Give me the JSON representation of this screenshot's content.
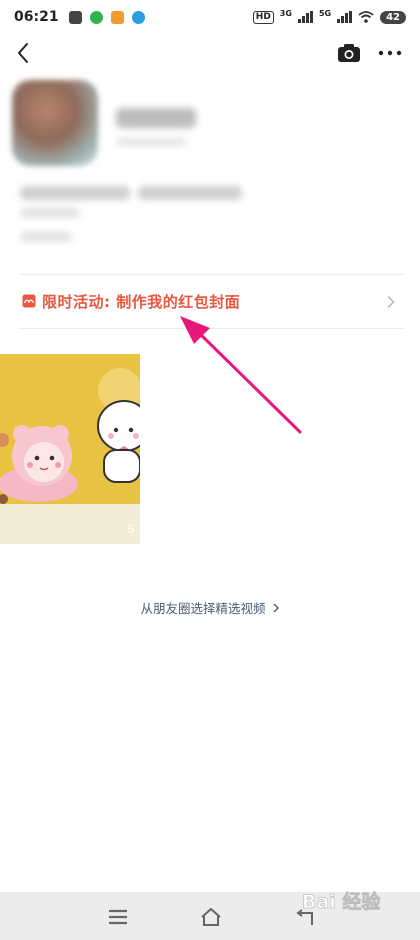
{
  "status_bar": {
    "time": "06:21",
    "hd_label": "HD",
    "net1": "3G",
    "net2": "5G",
    "battery": "42"
  },
  "nav": {
    "back_icon": "chevron-left-icon",
    "camera_icon": "camera-icon",
    "more_icon": "more-dots-icon"
  },
  "activity": {
    "label": "限时活动: 制作我的红包封面",
    "accent_color": "#e8573e"
  },
  "video": {
    "count": "5"
  },
  "moments_link": {
    "label": "从朋友圈选择精选视频"
  },
  "watermark": {
    "text": "Bai 经验"
  },
  "colors": {
    "annotation_arrow": "#e6197a",
    "thumbnail_bg": "#e8c342"
  }
}
